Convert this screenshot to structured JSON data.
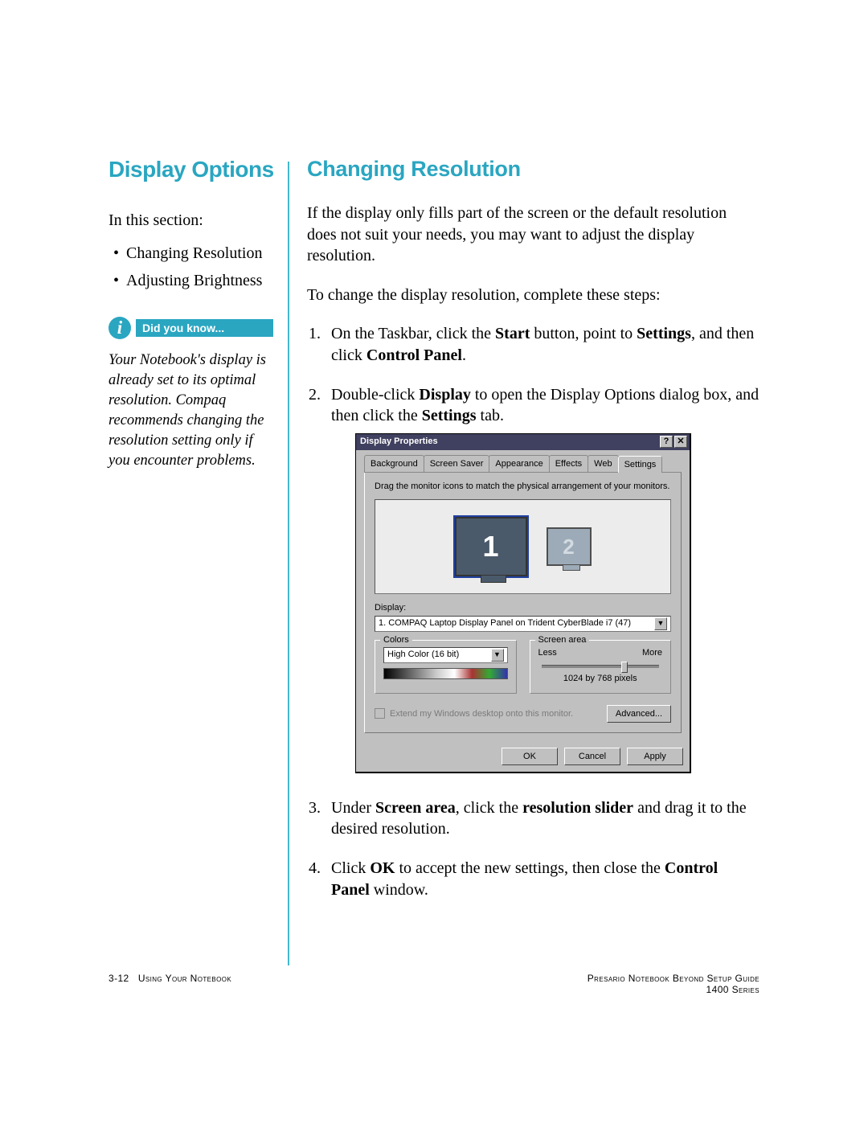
{
  "left": {
    "heading": "Display Options",
    "intro": "In this section:",
    "bullets": [
      "Changing Resolution",
      "Adjusting Brightness"
    ],
    "dyk_label": "Did you know...",
    "dyk_text": "Your Notebook's display is already set to its optimal resolution. Compaq recommends changing the resolution setting only if you encounter problems."
  },
  "right": {
    "heading": "Changing Resolution",
    "p1": "If the display only fills part of the screen or the default resolution does not suit your needs, you may want to adjust the display resolution.",
    "p2": "To change the display resolution, complete these steps:",
    "step1_a": "On the Taskbar, click the ",
    "step1_b": "Start",
    "step1_c": " button, point to ",
    "step1_d": "Settings",
    "step1_e": ", and then click ",
    "step1_f": "Control Panel",
    "step1_g": ".",
    "step2_a": "Double-click ",
    "step2_b": "Display",
    "step2_c": " to open the Display Options dialog box, and then click the ",
    "step2_d": "Settings",
    "step2_e": " tab.",
    "step3_a": "Under ",
    "step3_b": "Screen area",
    "step3_c": ", click the ",
    "step3_d": "resolution slider",
    "step3_e": " and drag it to the desired resolution.",
    "step4_a": "Click ",
    "step4_b": "OK",
    "step4_c": " to accept the new settings, then close the ",
    "step4_d": "Control Panel",
    "step4_e": " window."
  },
  "dialog": {
    "title": "Display Properties",
    "help": "?",
    "close": "✕",
    "tabs": [
      "Background",
      "Screen Saver",
      "Appearance",
      "Effects",
      "Web",
      "Settings"
    ],
    "active_tab": 5,
    "instruction": "Drag the monitor icons to match the physical arrangement of your monitors.",
    "monitor1": "1",
    "monitor2": "2",
    "display_label": "Display:",
    "display_value": "1. COMPAQ Laptop Display Panel on Trident CyberBlade i7 (47)",
    "colors_legend": "Colors",
    "colors_value": "High Color (16 bit)",
    "screen_legend": "Screen area",
    "less": "Less",
    "more": "More",
    "resolution": "1024 by 768 pixels",
    "extend_label": "Extend my Windows desktop onto this monitor.",
    "advanced": "Advanced...",
    "ok": "OK",
    "cancel": "Cancel",
    "apply": "Apply"
  },
  "footer": {
    "left_page": "3-12",
    "left_text": "Using Your Notebook",
    "right_line1": "Presario Notebook Beyond Setup Guide",
    "right_line2": "1400 Series"
  }
}
